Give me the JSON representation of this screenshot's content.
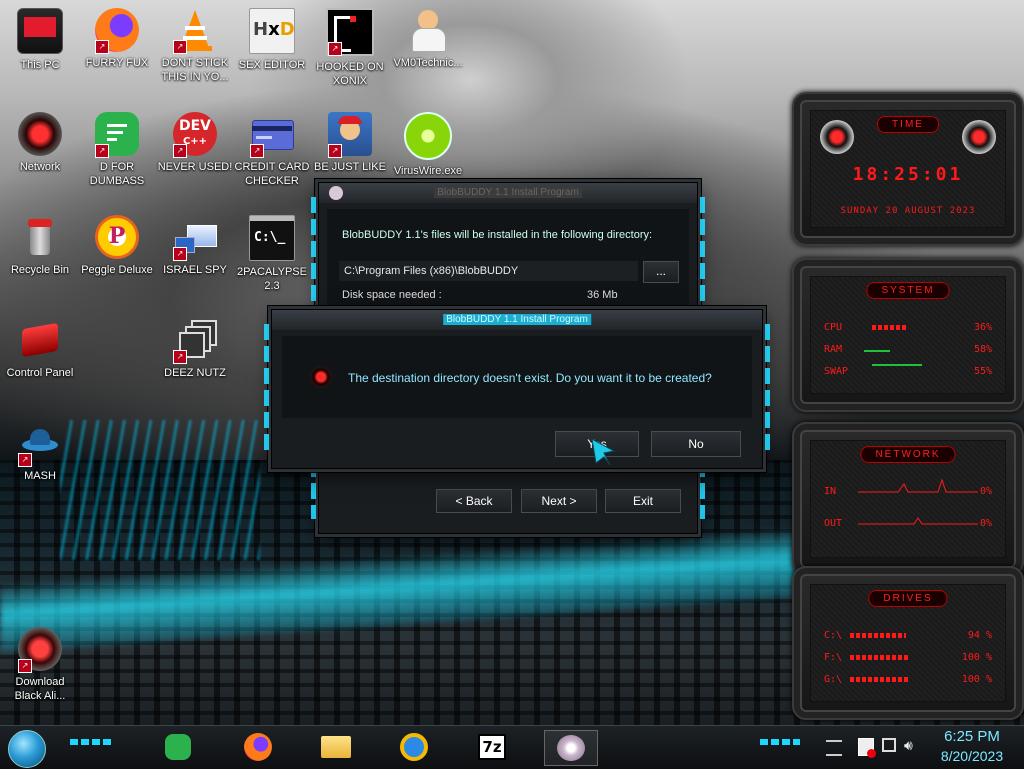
{
  "desktop": {
    "icons": [
      {
        "label": "This PC"
      },
      {
        "label": "FURRY FUX"
      },
      {
        "label": "DONT STICK THIS IN YO..."
      },
      {
        "label": "SEX EDITOR"
      },
      {
        "label": "HOOKED ON XONIX"
      },
      {
        "label": "VM0Technic..."
      },
      {
        "label": "Network"
      },
      {
        "label": "D FOR DUMBASS"
      },
      {
        "label": "NEVER USED!"
      },
      {
        "label": "CREDIT CARD CHECKER"
      },
      {
        "label": "BE JUST LIKE"
      },
      {
        "label": "VirusWire.exe"
      },
      {
        "label": "Recycle Bin"
      },
      {
        "label": "Peggle Deluxe"
      },
      {
        "label": "ISRAEL SPY"
      },
      {
        "label": "2PACALYPSE 2.3"
      },
      {
        "label": "Control Panel"
      },
      {
        "label": "DEEZ NUTZ"
      },
      {
        "label": "MASH"
      },
      {
        "label": "Download Black Ali..."
      }
    ],
    "dev_badge": "DEV",
    "dev_badge_sub": "C++",
    "cmd_glyph": "C:\\_"
  },
  "widgets": {
    "time": {
      "title": "TIME",
      "clock": "18:25:01",
      "date": "SUNDAY 20 AUGUST 2023"
    },
    "system": {
      "title": "SYSTEM",
      "rows": [
        {
          "label": "CPU",
          "pct": "36%",
          "fill": 0.36
        },
        {
          "label": "RAM",
          "pct": "58%",
          "fill": 0.58
        },
        {
          "label": "SWAP",
          "pct": "55%",
          "fill": 0.55
        }
      ]
    },
    "network": {
      "title": "NETWORK",
      "rows": [
        {
          "label": "IN",
          "pct": "0%"
        },
        {
          "label": "OUT",
          "pct": "0%"
        }
      ]
    },
    "drives": {
      "title": "DRIVES",
      "rows": [
        {
          "label": "C:\\",
          "pct": "94 %",
          "fill": 0.94
        },
        {
          "label": "F:\\",
          "pct": "100 %",
          "fill": 1.0
        },
        {
          "label": "G:\\",
          "pct": "100 %",
          "fill": 1.0
        }
      ]
    }
  },
  "installer": {
    "title": "BlobBUDDY 1.1 Install Program",
    "intro": "BlobBUDDY 1.1's files will be installed in the following directory:",
    "path": "C:\\Program Files (x86)\\BlobBUDDY",
    "browse": "...",
    "disk_label": "Disk space needed :",
    "disk_value": "36 Mb",
    "back": "< Back",
    "next": "Next >",
    "exit": "Exit"
  },
  "dialog": {
    "title": "BlobBUDDY 1.1 Install Program",
    "message": "The destination directory doesn't exist. Do you want it to be created?",
    "yes": "Yes",
    "no": "No"
  },
  "taskbar": {
    "apps": [
      "feedly-icon",
      "firefox-icon",
      "file-explorer-icon",
      "internet-explorer-icon",
      "7zip-icon",
      "blobbuddy-icon"
    ],
    "sevenzip_label": "7z",
    "time": "6:25 PM",
    "date": "8/20/2023"
  }
}
